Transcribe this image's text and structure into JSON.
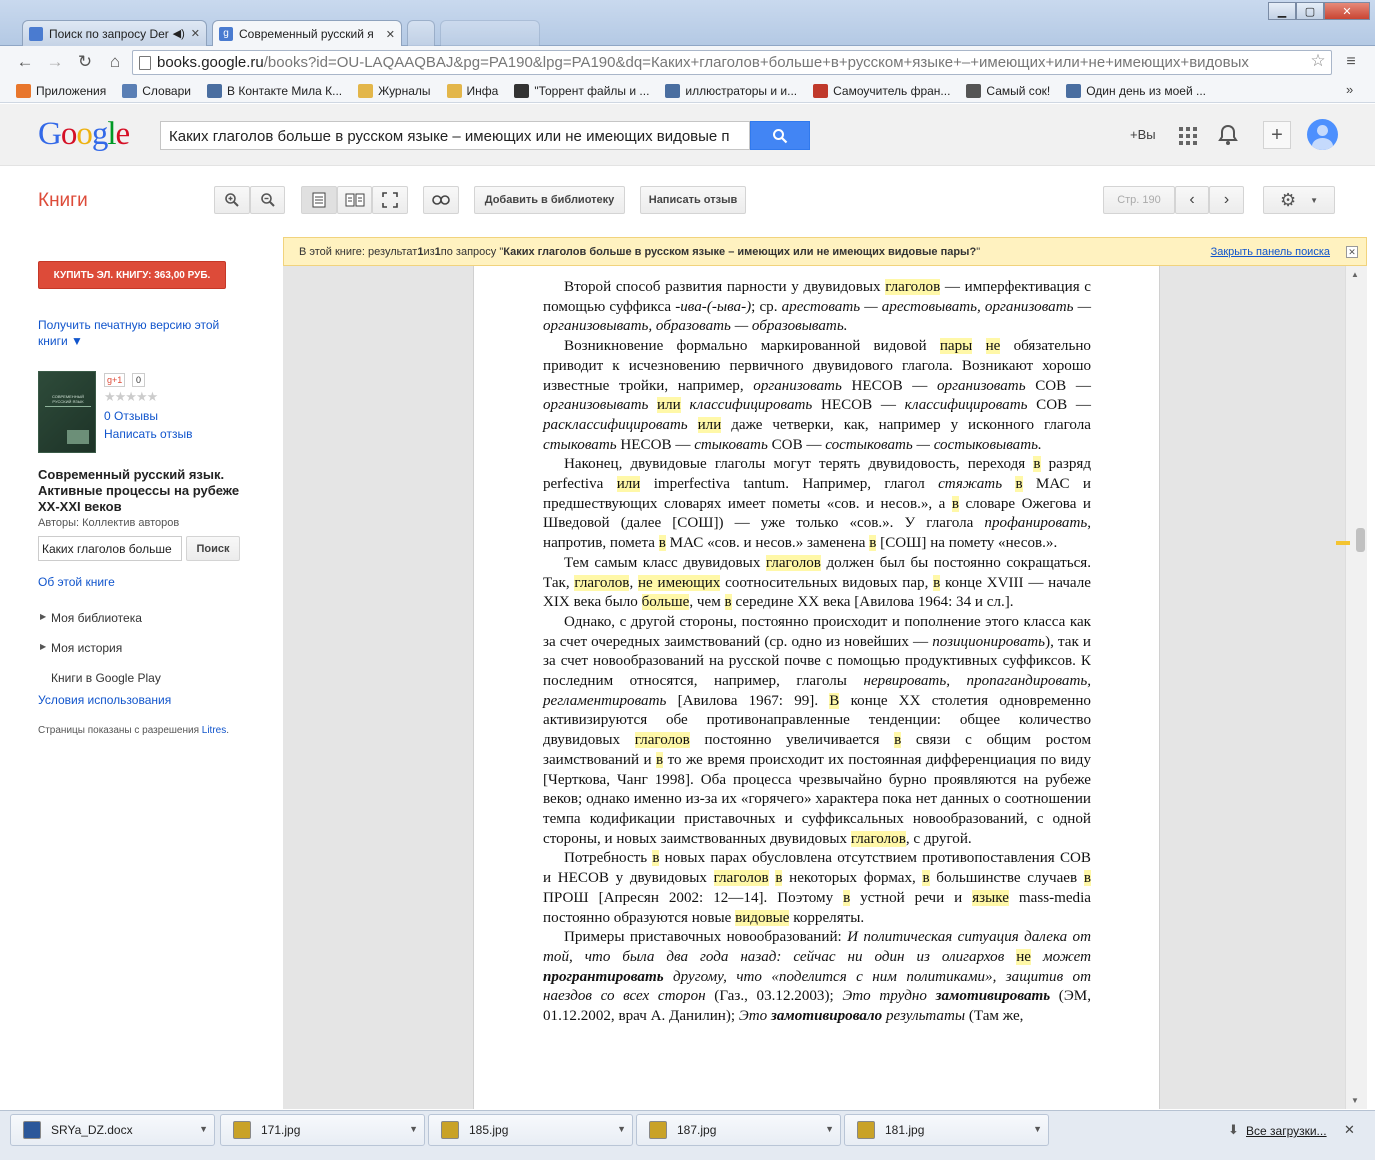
{
  "tabs": [
    {
      "title": "Поиск по запросу Der",
      "active": false
    },
    {
      "title": "Современный русский я",
      "active": true
    },
    {
      "title": "",
      "active": false
    },
    {
      "title": "",
      "active": false
    }
  ],
  "omnibox": {
    "host": "books.google.ru",
    "path": "/books?id=OU-LAQAAQBAJ&pg=PA190&lpg=PA190&dq=Каких+глаголов+больше+в+русском+языке+–+имеющих+или+не+имеющих+видовых"
  },
  "bookmarks": [
    {
      "label": "Приложения",
      "color": "#e8762c"
    },
    {
      "label": "Словари",
      "color": "#5a7fb5"
    },
    {
      "label": "В Контакте Мила К...",
      "color": "#4a6ea0"
    },
    {
      "label": "Журналы",
      "color": "#e3b64a"
    },
    {
      "label": "Инфа",
      "color": "#e3b64a"
    },
    {
      "label": "\"Торрент файлы и ...",
      "color": "#333333"
    },
    {
      "label": "иллюстраторы и и...",
      "color": "#4a6ea0"
    },
    {
      "label": "Самоучитель фран...",
      "color": "#c0392b"
    },
    {
      "label": "Самый сок!",
      "color": "#555555"
    },
    {
      "label": "Один день из моей ...",
      "color": "#4a6ea0"
    }
  ],
  "bookmarks_more": "»",
  "google": {
    "search_value": "Каких глаголов больше в русском языке – имеющих или не имеющих видовые п",
    "plus_you": "+Вы"
  },
  "books": {
    "title": "Книги",
    "add_library": "Добавить в библиотеку",
    "write_review": "Написать отзыв",
    "page_label": "Стр. 190"
  },
  "result_panel": {
    "text_a": "В этой книге: результат ",
    "n1": "1",
    "text_b": " из ",
    "n2": "1",
    "text_c": " по запросу \"",
    "query": "Каких глаголов больше в русском языке – имеющих или не имеющих видовые пары?",
    "text_d": "\"",
    "close": "Закрыть панель поиска"
  },
  "sidebar": {
    "buy": "КУПИТЬ ЭЛ. КНИГУ: 363,00 РУБ.",
    "print_version": "Получить печатную версию этой книги ▼",
    "gplus": "g+1",
    "gplus_count": "0",
    "reviews": "0 Отзывы",
    "write_review": "Написать отзыв",
    "book_title": "Современный русский язык. Активные процессы на рубеже XX-XXI веков",
    "authors": "Авторы: Коллектив авторов",
    "search_value": "Каких глаголов больше",
    "search_btn": "Поиск",
    "about": "Об этой книге",
    "my_library": "Моя библиотека",
    "my_history": "Моя история",
    "play": "Книги в Google Play",
    "terms": "Условия использования",
    "permission": "Страницы показаны с разрешения ",
    "permission_link": "Litres",
    "permission_end": ".",
    "cover_text": "СОВРЕМЕННЫЙ РУССКИЙ ЯЗЫК"
  },
  "downloads": [
    {
      "name": "SRYa_DZ.docx",
      "color": "#2b579a"
    },
    {
      "name": "171.jpg",
      "color": "#c9a227"
    },
    {
      "name": "185.jpg",
      "color": "#c9a227"
    },
    {
      "name": "187.jpg",
      "color": "#c9a227"
    },
    {
      "name": "181.jpg",
      "color": "#c9a227"
    }
  ],
  "all_downloads": "Все загрузки...",
  "text": {
    "p1a": "Второй способ развития парности у двувидовых ",
    "p1h": "глаголов",
    "p1b": " — имперфективация с помощью суффикса ",
    "p1i": "-ива-(-ыва-)",
    "p1c": "; ср. ",
    "p1d": "арестовать — арестовывать, организовать — организовывать, образовать — образовывать.",
    "p2a": "Возникновение формально маркированной видовой ",
    "p2h1": "пары",
    "p2s": " ",
    "p2h2": "не",
    "p2b": " обязательно приводит к исчезновению первичного двувидового глагола. Возникают хорошо известные тройки, например, ",
    "p2i1": "организовать",
    "p2c": " НЕСОВ — ",
    "p2i2": "организовать",
    "p2d": " СОВ — ",
    "p2i3": "организовывать",
    "p2e": " ",
    "p2h3": "или",
    "p2f": " ",
    "p2i4": "классифицировать",
    "p2g": " НЕСОВ — ",
    "p2i5": "классифицировать",
    "p2j": " СОВ — ",
    "p2i6": "расклассифицировать",
    "p2k": " ",
    "p2h4": "или",
    "p2l": " даже четверки, как, например у исконного глагола ",
    "p2i7": "стыковать",
    "p2m": " НЕСОВ — ",
    "p2i8": "стыковать",
    "p2n": " СОВ — ",
    "p2i9": "состыковать — состыковывать.",
    "p3a": "Наконец, двувидовые глаголы могут терять двувидовость, переходя ",
    "p3h1": "в",
    "p3b": " разряд perfectiva ",
    "p3h2": "или",
    "p3c": " imperfectiva tantum. Например, глагол ",
    "p3i1": "стяжать",
    "p3d": " ",
    "p3h3": "в",
    "p3e": " МАС и предшествующих словарях имеет пометы «сов. и несов.», а ",
    "p3h4": "в",
    "p3f": " словаре Ожегова и Шведовой (далее [СОШ]) — уже только «сов.». У глагола ",
    "p3i2": "профанировать",
    "p3g": ", напротив, помета ",
    "p3h5": "в",
    "p3j": " МАС «сов. и несов.» заменена ",
    "p3h6": "в",
    "p3k": " [СОШ] на помету «несов.».",
    "p4a": "Тем самым класс двувидовых ",
    "p4h1": "глаголов",
    "p4b": " должен был бы постоянно сокращаться. Так, ",
    "p4h2": "глаголов",
    "p4c": ", ",
    "p4h3": "не имеющих",
    "p4d": " соотносительных видовых пар, ",
    "p4h4": "в",
    "p4e": " конце XVIII — начале XIX века было ",
    "p4h5": "больше",
    "p4f": ", чем ",
    "p4h6": "в",
    "p4g": " середине XX века [Авилова 1964: 34 и сл.].",
    "p5a": "Однако, с другой стороны, постоянно происходит и пополнение этого класса как за счет очередных заимствований (ср. одно из новейших — ",
    "p5i1": "позиционировать",
    "p5b": "), так и за счет новообразований на русской почве с помощью продуктивных суффиксов. К последним относятся, например, глаголы ",
    "p5i2": "нервировать, пропагандировать, регламентировать",
    "p5c": " [Авилова 1967: 99]. ",
    "p5h1": "В",
    "p5d": " конце XX столетия одновременно активизируются обе противонаправленные тенденции: общее количество двувидовых ",
    "p5h2": "глаголов",
    "p5e": " постоянно увеличивается ",
    "p5h3": "в",
    "p5f": " связи с общим ростом заимствований и ",
    "p5h4": "в",
    "p5g": " то же время происходит их постоянная дифференциация по виду [Черткова, Чанг 1998]. Оба процесса чрезвычайно бурно проявляются на рубеже веков; однако именно из-за их «горячего» характера пока нет данных о соотношении темпа кодификации приставочных и суффиксальных новообразований, с одной стороны, и новых заимствованных двувидовых ",
    "p5h5": "глаголов",
    "p5j": ", с другой.",
    "p6a": "Потребность ",
    "p6h1": "в",
    "p6b": " новых парах обусловлена отсутствием противопоставления СОВ и НЕСОВ у двувидовых ",
    "p6h2": "глаголов",
    "p6c": " ",
    "p6h3": "в",
    "p6d": " некоторых формах, ",
    "p6h4": "в",
    "p6e": " большинстве случаев ",
    "p6h5": "в",
    "p6f": " ПРОШ [Апресян 2002: 12—14]. Поэтому ",
    "p6h6": "в",
    "p6g": " устной речи и ",
    "p6h7": "языке",
    "p6j": " mass-media постоянно образуются новые ",
    "p6h8": "видовые",
    "p6k": " корреляты.",
    "p7a": "Примеры приставочных новообразований: ",
    "p7i1": "И политическая ситуация далека от той, что была два года назад: сейчас ни один из олигархов ",
    "p7h1": "не",
    "p7i2": " может ",
    "p7b1": "програнтировать",
    "p7i3": " другому, что «поделится с ним политиками», защитив от наездов со всех сторон",
    "p7c": " (Газ., 03.12.2003); ",
    "p7i4": "Это трудно ",
    "p7b2": "замотивировать",
    "p7d": " (ЭМ, 01.12.2002, врач А. Данилин); ",
    "p7i5": "Это ",
    "p7b3": "замотивировало",
    "p7i6": " результаты",
    "p7e": " (Там же,"
  }
}
